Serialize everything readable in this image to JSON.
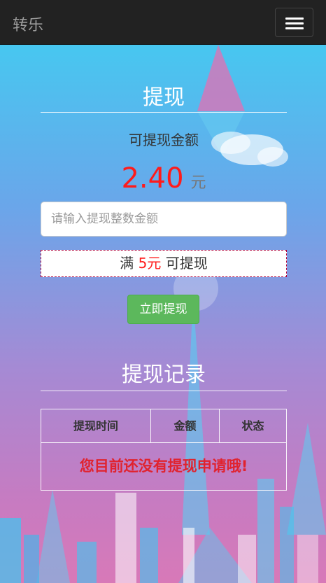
{
  "navbar": {
    "brand": "转乐",
    "menu_icon": "hamburger-icon"
  },
  "withdraw": {
    "title": "提现",
    "available_label": "可提现金额",
    "amount": "2.40",
    "unit": "元",
    "input_placeholder": "请输入提现整数金额",
    "notice_prefix": "满",
    "notice_amount": "5元",
    "notice_suffix": "可提现",
    "submit_label": "立即提现"
  },
  "records": {
    "title": "提现记录",
    "columns": [
      "提现时间",
      "金额",
      "状态"
    ],
    "empty_message": "您目前还没有提现申请哦!"
  },
  "colors": {
    "accent_red": "#ff1b1b",
    "button_green": "#5cb85c",
    "navbar": "#222222"
  }
}
